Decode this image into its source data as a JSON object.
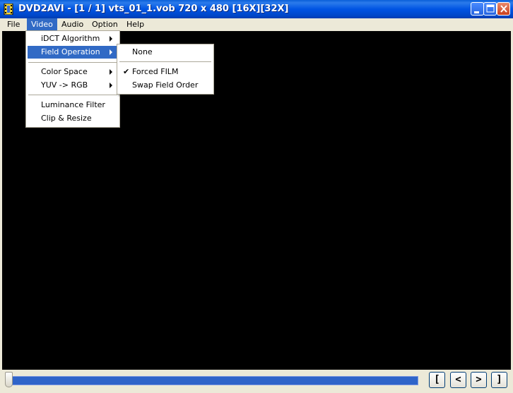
{
  "window": {
    "title": "DVD2AVI - [1 / 1] vts_01_1.vob 720 x 480 [16X][32X]"
  },
  "menubar": {
    "items": [
      {
        "label": "File",
        "active": false
      },
      {
        "label": "Video",
        "active": true
      },
      {
        "label": "Audio",
        "active": false
      },
      {
        "label": "Option",
        "active": false
      },
      {
        "label": "Help",
        "active": false
      }
    ]
  },
  "video_menu": {
    "items": [
      {
        "label": "iDCT Algorithm",
        "submenu": true
      },
      {
        "label": "Field Operation",
        "submenu": true,
        "highlighted": true
      },
      {
        "label": "Color Space",
        "submenu": true
      },
      {
        "label": "YUV -> RGB",
        "submenu": true
      },
      {
        "label": "Luminance Filter",
        "submenu": false
      },
      {
        "label": "Clip & Resize",
        "submenu": false
      }
    ]
  },
  "field_operation_menu": {
    "items": [
      {
        "label": "None",
        "checked": false
      },
      {
        "label": "Forced FILM",
        "checked": true
      },
      {
        "label": "Swap Field Order",
        "checked": false
      }
    ]
  },
  "navigation": {
    "buttons": [
      {
        "label": "[",
        "icon": "mark-start-icon"
      },
      {
        "label": "<",
        "icon": "previous-icon"
      },
      {
        "label": ">",
        "icon": "next-icon"
      },
      {
        "label": "]",
        "icon": "mark-end-icon"
      }
    ],
    "position": 0
  },
  "colors": {
    "titlebar": "#0054E3",
    "highlight": "#316AC5",
    "video_bg": "#000000",
    "track": "#2F64C9"
  }
}
